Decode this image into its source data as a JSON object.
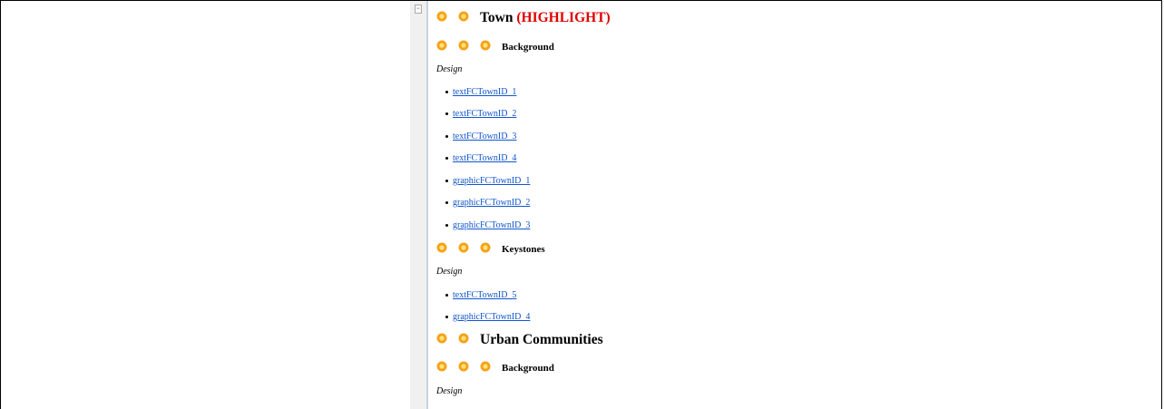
{
  "outline": {
    "town_heading": {
      "label": "Town",
      "highlight": "(HIGHLIGHT)",
      "icon": "sun-icon"
    },
    "town_background": {
      "label": "Background"
    },
    "town_bg_design": {
      "label": "Design"
    },
    "town_bg_links": [
      "textFCTownID_1",
      "textFCTownID_2",
      "textFCTownID_3",
      "textFCTownID_4",
      "graphicFCTownID_1",
      "graphicFCTownID_2",
      "graphicFCTownID_3"
    ],
    "town_keystones": {
      "label": "Keystones"
    },
    "town_ks_design": {
      "label": "Design"
    },
    "town_ks_links": [
      "textFCTownID_5",
      "graphicFCTownID_4"
    ],
    "urban_heading": {
      "label": "Urban Communities"
    },
    "urban_background": {
      "label": "Background"
    },
    "urban_bg_design": {
      "label": "Design"
    }
  },
  "colors": {
    "highlight": "#e00000",
    "link": "#1155cc",
    "icon_outer": "#f6a21a",
    "icon_inner": "#ffe27a"
  }
}
